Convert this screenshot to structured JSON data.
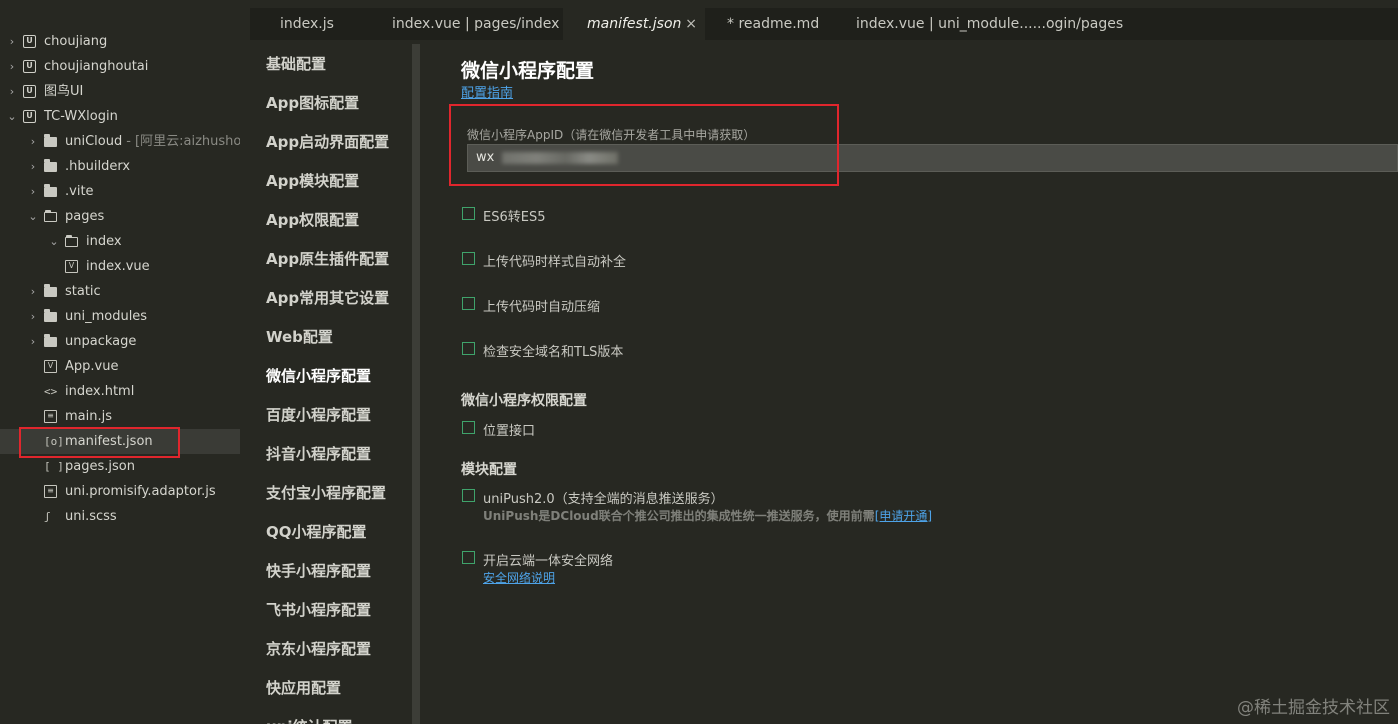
{
  "explorer": {
    "items": [
      {
        "label": "choujiang",
        "icon": "project-icon",
        "hint": "",
        "chevron": "›"
      },
      {
        "label": "choujianghoutai",
        "icon": "project-icon",
        "hint": "",
        "chevron": "›"
      },
      {
        "label": "图鸟UI",
        "icon": "project-icon",
        "hint": "",
        "chevron": "›"
      },
      {
        "label": "TC-WXlogin",
        "icon": "project-icon",
        "hint": "",
        "chevron": "⌄"
      },
      {
        "label": "uniCloud",
        "icon": "folder-icon",
        "hint": "- [阿里云:aizhushou]",
        "chevron": "›"
      },
      {
        "label": ".hbuilderx",
        "icon": "folder-icon",
        "hint": "",
        "chevron": "›"
      },
      {
        "label": ".vite",
        "icon": "folder-icon",
        "hint": "",
        "chevron": "›"
      },
      {
        "label": "pages",
        "icon": "folder-open-icon",
        "hint": "",
        "chevron": "⌄"
      },
      {
        "label": "index",
        "icon": "folder-open-icon",
        "hint": "",
        "chevron": "⌄"
      },
      {
        "label": "index.vue",
        "icon": "vue-file-icon",
        "hint": "",
        "chevron": ""
      },
      {
        "label": "static",
        "icon": "folder-icon",
        "hint": "",
        "chevron": "›"
      },
      {
        "label": "uni_modules",
        "icon": "folder-icon",
        "hint": "",
        "chevron": "›"
      },
      {
        "label": "unpackage",
        "icon": "folder-icon",
        "hint": "",
        "chevron": "›"
      },
      {
        "label": "App.vue",
        "icon": "vue-file-icon",
        "hint": "",
        "chevron": ""
      },
      {
        "label": "index.html",
        "icon": "html-file-icon",
        "hint": "",
        "chevron": ""
      },
      {
        "label": "main.js",
        "icon": "js-file-icon",
        "hint": "",
        "chevron": ""
      },
      {
        "label": "manifest.json",
        "icon": "manifest-file-icon",
        "hint": "",
        "chevron": ""
      },
      {
        "label": "pages.json",
        "icon": "json-file-icon",
        "hint": "",
        "chevron": ""
      },
      {
        "label": "uni.promisify.adaptor.js",
        "icon": "js-file-icon",
        "hint": "",
        "chevron": ""
      },
      {
        "label": "uni.scss",
        "icon": "scss-file-icon",
        "hint": "",
        "chevron": ""
      }
    ]
  },
  "tabs": [
    {
      "label": "index.js"
    },
    {
      "label": "index.vue | pages/index"
    },
    {
      "label": "manifest.json",
      "close": "×"
    },
    {
      "label": "* readme.md"
    },
    {
      "label": "index.vue | uni_module......ogin/pages"
    }
  ],
  "settings_nav": [
    "基础配置",
    "App图标配置",
    "App启动界面配置",
    "App模块配置",
    "App权限配置",
    "App原生插件配置",
    "App常用其它设置",
    "Web配置",
    "微信小程序配置",
    "百度小程序配置",
    "抖音小程序配置",
    "支付宝小程序配置",
    "QQ小程序配置",
    "快手小程序配置",
    "飞书小程序配置",
    "京东小程序配置",
    "快应用配置",
    "uni统计配置"
  ],
  "main": {
    "title": "微信小程序配置",
    "guide_link": "配置指南",
    "appid_label": "微信小程序AppID（请在微信开发者工具中申请获取）",
    "appid_value": "wx",
    "options": [
      {
        "label": "ES6转ES5",
        "checked": false
      },
      {
        "label": "上传代码时样式自动补全",
        "checked": false
      },
      {
        "label": "上传代码时自动压缩",
        "checked": false
      },
      {
        "label": "检查安全域名和TLS版本",
        "checked": false
      }
    ],
    "permission_section": "微信小程序权限配置",
    "permission_option": "位置接口",
    "module_section": "模块配置",
    "unipush_option": "uniPush2.0（支持全端的消息推送服务）",
    "unipush_desc": "UniPush是DCloud联合个推公司推出的集成性统一推送服务，使用前需",
    "unipush_link": "[申请开通]",
    "cloud_option": "开启云端一体安全网络",
    "cloud_link": "安全网络说明"
  },
  "watermark": "@稀土掘金技术社区",
  "colors": {
    "background": "#272822",
    "accent_link": "#4ea3e8",
    "highlight_box": "#e0262d",
    "checkbox_border": "#3fa36b"
  }
}
